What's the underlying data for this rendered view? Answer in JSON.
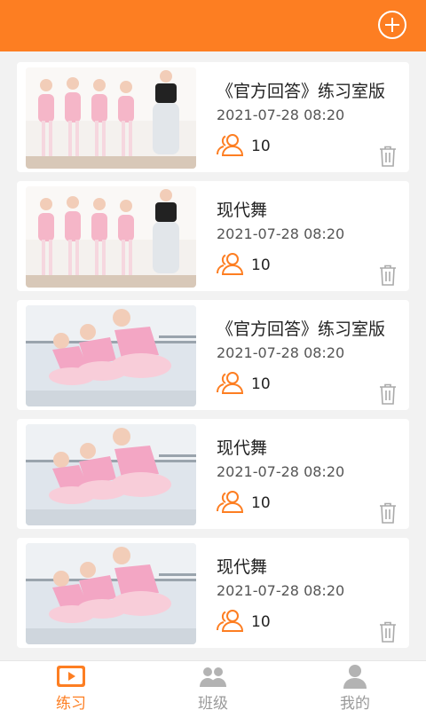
{
  "header": {
    "add_icon": "plus-circle-icon",
    "color": "#fd7e22"
  },
  "cards": [
    {
      "title": "《官方回答》练习室版",
      "date": "2021-07-28 08:20",
      "count": "10",
      "image": "ballet-girls-standing"
    },
    {
      "title": "现代舞",
      "date": "2021-07-28 08:20",
      "count": "10",
      "image": "ballet-girls-standing"
    },
    {
      "title": "《官方回答》练习室版",
      "date": "2021-07-28 08:20",
      "count": "10",
      "image": "ballet-girls-barre"
    },
    {
      "title": "现代舞",
      "date": "2021-07-28 08:20",
      "count": "10",
      "image": "ballet-girls-barre"
    },
    {
      "title": "现代舞",
      "date": "2021-07-28 08:20",
      "count": "10",
      "image": "ballet-girls-barre"
    }
  ],
  "tabs": [
    {
      "label": "练习",
      "icon": "video-play-icon",
      "active": true
    },
    {
      "label": "班级",
      "icon": "group-icon",
      "active": false
    },
    {
      "label": "我的",
      "icon": "person-icon",
      "active": false
    }
  ]
}
